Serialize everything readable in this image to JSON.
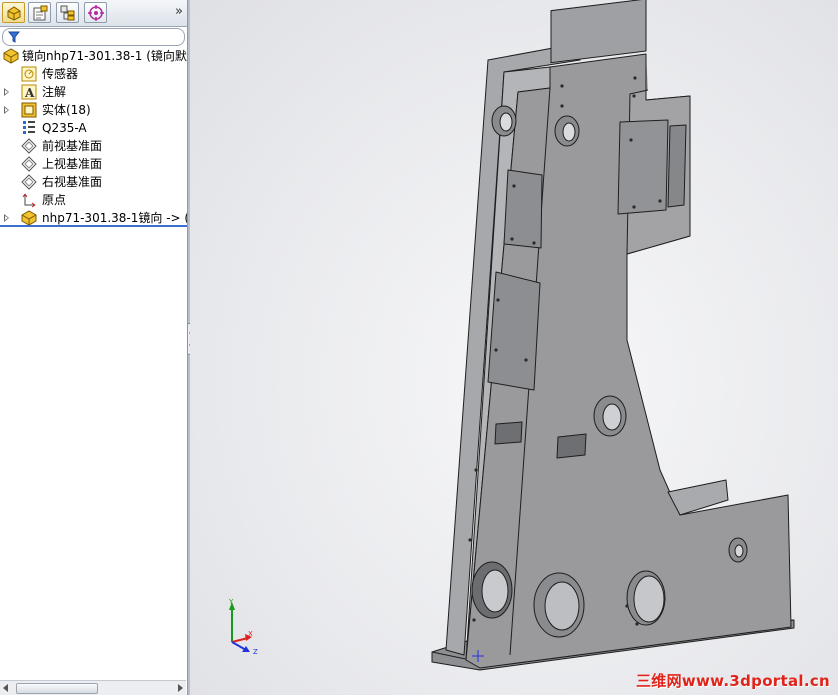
{
  "tabs": [
    {
      "name": "featuremanager",
      "icon": "featuremanager-icon",
      "active": true
    },
    {
      "name": "propertymanager",
      "icon": "propertymanager-icon",
      "active": false
    },
    {
      "name": "configurationmanager",
      "icon": "configurationmanager-icon",
      "active": false
    },
    {
      "name": "dimxpert",
      "icon": "dimxpert-crosshair-icon",
      "active": false
    }
  ],
  "tab_overflow": "»",
  "filter": {
    "icon": "filter-icon",
    "value": ""
  },
  "tree": {
    "root": {
      "label": "镜向nhp71-301.38-1  (镜向默",
      "icon": "part-icon"
    },
    "items": [
      {
        "label": "传感器",
        "icon": "sensor-icon",
        "expandable": false
      },
      {
        "label": "注解",
        "icon": "annotation-icon",
        "expandable": true
      },
      {
        "label": "实体(18)",
        "icon": "solid-bodies-icon",
        "expandable": true
      },
      {
        "label": "Q235-A",
        "icon": "material-icon",
        "expandable": false
      },
      {
        "label": "前视基准面",
        "icon": "plane-icon",
        "expandable": false
      },
      {
        "label": "上视基准面",
        "icon": "plane-icon",
        "expandable": false
      },
      {
        "label": "右视基准面",
        "icon": "plane-icon",
        "expandable": false
      },
      {
        "label": "原点",
        "icon": "origin-icon",
        "expandable": false
      },
      {
        "label": "nhp71-301.38-1镜向 -> (镜",
        "icon": "part-icon",
        "expandable": true
      }
    ]
  },
  "triad": {
    "x": "X",
    "y": "Y",
    "z": "Z"
  },
  "colors": {
    "model_face": "#9a9a9d",
    "model_edge": "#1e1e1e",
    "triad_x": "#d22",
    "triad_y": "#1a9a1a",
    "triad_z": "#2233dd",
    "watermark": "#e0241b"
  },
  "watermark": "三维网www.3dportal.cn"
}
